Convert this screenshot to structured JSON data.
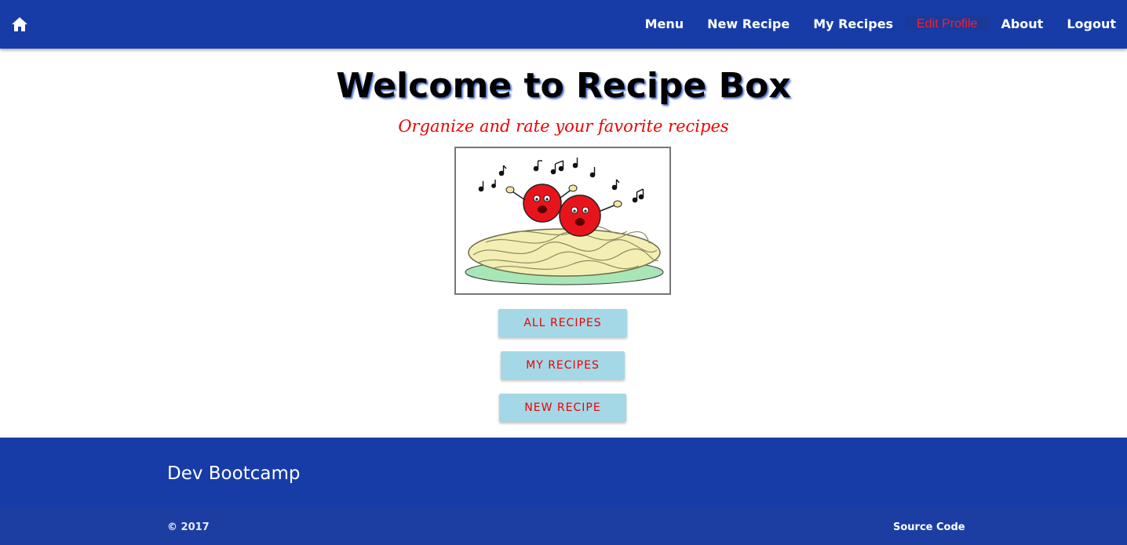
{
  "navbar": {
    "home_icon": "home-icon",
    "links": [
      {
        "label": "Menu"
      },
      {
        "label": "New Recipe"
      },
      {
        "label": "My Recipes"
      },
      {
        "label": "Edit Profile"
      },
      {
        "label": "About"
      },
      {
        "label": "Logout"
      }
    ],
    "active_link": "Edit Profile",
    "colors": {
      "background": "#173ca8",
      "active_text": "#ff1a2e"
    }
  },
  "main": {
    "title": "Welcome to Recipe Box",
    "subtitle": "Organize and rate your favorite recipes",
    "hero_image": "singing-meatballs-spaghetti-illustration",
    "buttons": {
      "all_recipes": "ALL RECIPES",
      "my_recipes": "MY RECIPES",
      "new_recipe": "NEW RECIPE"
    },
    "colors": {
      "button_bg": "#a4d8e6",
      "button_text": "#ee0000",
      "subtitle": "#ee0000"
    }
  },
  "footer": {
    "brand": "Dev Bootcamp",
    "copyright": "© 2017",
    "source_link": "Source Code"
  }
}
